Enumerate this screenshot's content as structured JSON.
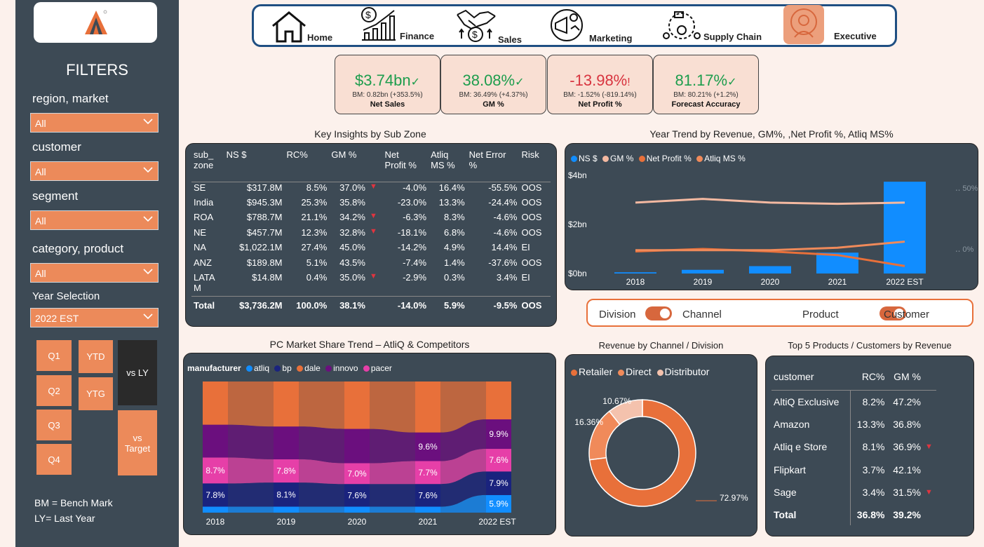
{
  "sidebar": {
    "heading": "FILTERS",
    "filters": [
      {
        "label": "region, market",
        "value": "All"
      },
      {
        "label": "customer",
        "value": "All"
      },
      {
        "label": "segment",
        "value": "All"
      },
      {
        "label": "category, product",
        "value": "All"
      },
      {
        "label": "Year Selection",
        "value": "2022 EST"
      }
    ],
    "quarters": [
      "Q1",
      "Q2",
      "Q3",
      "Q4"
    ],
    "ytd": "YTD",
    "ytg": "YTG",
    "vs_ly": "vs LY",
    "vs_target": "vs\nTarget",
    "bm_note": "BM = Bench Mark",
    "ly_note": "LY= Last Year"
  },
  "nav": {
    "items": [
      "Home",
      "Finance",
      "Sales",
      "Marketing",
      "Supply Chain",
      "Executive"
    ]
  },
  "kpis": [
    {
      "value": "$3.74bn",
      "mark": "✓",
      "bm": "BM: 0.82bn (+353.5%)",
      "label": "Net Sales",
      "color": "#1d9d4d"
    },
    {
      "value": "38.08%",
      "mark": "✓",
      "bm": "BM: 36.49% (+4.37%)",
      "label": "GM %",
      "color": "#1d9d4d"
    },
    {
      "value": "-13.98%",
      "mark": "!",
      "bm": "BM: -1.52% (-819.14%)",
      "label": "Net Profit %",
      "color": "#d8343f"
    },
    {
      "value": "81.17%",
      "mark": "✓",
      "bm": "BM: 80.21% (+1.2%)",
      "label": "Forecast Accuracy",
      "color": "#1d9d4d"
    }
  ],
  "insights": {
    "title": "Key Insights by Sub Zone",
    "headers": [
      "sub_\nzone",
      "NS $",
      "RC%",
      "GM %",
      "Net\nProfit %",
      "Atliq\nMS %",
      "Net Error\n%",
      "Risk"
    ],
    "rows": [
      [
        "SE",
        "$317.8M",
        "8.5%",
        "37.0%",
        "-4.0%",
        "16.4%",
        "-55.5%",
        "OOS"
      ],
      [
        "India",
        "$945.3M",
        "25.3%",
        "35.8%",
        "-23.0%",
        "13.3%",
        "-24.4%",
        "OOS"
      ],
      [
        "ROA",
        "$788.7M",
        "21.1%",
        "34.2%",
        "-6.3%",
        "8.3%",
        "-4.6%",
        "OOS"
      ],
      [
        "NE",
        "$457.7M",
        "12.3%",
        "32.8%",
        "-18.1%",
        "6.8%",
        "-4.6%",
        "OOS"
      ],
      [
        "NA",
        "$1,022.1M",
        "27.4%",
        "45.0%",
        "-14.2%",
        "4.9%",
        "14.4%",
        "EI"
      ],
      [
        "ANZ",
        "$189.8M",
        "5.1%",
        "43.5%",
        "-7.4%",
        "1.4%",
        "-37.6%",
        "OOS"
      ],
      [
        "LATA\nM",
        "$14.8M",
        "0.4%",
        "35.0%",
        "-2.9%",
        "0.3%",
        "3.4%",
        "EI"
      ]
    ],
    "down_flags": [
      true,
      false,
      true,
      true,
      false,
      false,
      true
    ],
    "total": [
      "Total",
      "$3,736.2M",
      "100.0%",
      "38.1%",
      "-14.0%",
      "5.9%",
      "-9.5%",
      "OOS"
    ]
  },
  "trend": {
    "title": "Year Trend by Revenue, GM%, ,Net Profit %, Atliq MS%",
    "legend": [
      {
        "name": "NS $",
        "color": "#118dff"
      },
      {
        "name": "GM %",
        "color": "#f4b9a1"
      },
      {
        "name": "Net Profit %",
        "color": "#e8703a"
      },
      {
        "name": "Atliq MS %",
        "color": "#f08a5a"
      }
    ]
  },
  "toggles": {
    "a": "Division",
    "b": "Channel",
    "c": "Product",
    "d": "Customer"
  },
  "market": {
    "title": "PC Market Share Trend – AtliQ  & Competitors",
    "legend_title": "manufacturer",
    "legend": [
      {
        "name": "atliq",
        "color": "#118dff"
      },
      {
        "name": "bp",
        "color": "#1a237e"
      },
      {
        "name": "dale",
        "color": "#e8703a"
      },
      {
        "name": "innovo",
        "color": "#6b0f7e"
      },
      {
        "name": "pacer",
        "color": "#e63fa8"
      }
    ]
  },
  "channel": {
    "title": "Revenue by Channel / Division",
    "legend": [
      {
        "name": "Retailer",
        "color": "#e8703a"
      },
      {
        "name": "Direct",
        "color": "#f08a5a"
      },
      {
        "name": "Distributor",
        "color": "#f4c2ad"
      }
    ]
  },
  "top5": {
    "title": "Top 5 Products / Customers by Revenue",
    "headers": [
      "customer",
      "RC%",
      "GM %"
    ],
    "rows": [
      [
        "AltiQ Exclusive",
        "8.2%",
        "47.2%"
      ],
      [
        "Amazon",
        "13.3%",
        "36.8%"
      ],
      [
        "Atliq e Store",
        "8.1%",
        "36.9%"
      ],
      [
        "Flipkart",
        "3.7%",
        "42.1%"
      ],
      [
        "Sage",
        "3.4%",
        "31.5%"
      ]
    ],
    "down_flags": [
      false,
      false,
      true,
      false,
      true
    ],
    "total": [
      "Total",
      "36.8%",
      "39.2%"
    ]
  },
  "chart_data": [
    {
      "type": "bar",
      "title": "Year Trend by Revenue, GM%, ,Net Profit %, Atliq MS%",
      "categories": [
        "2018",
        "2019",
        "2020",
        "2021",
        "2022 EST"
      ],
      "y_ticks": [
        "$0bn",
        "$2bn",
        "$4bn"
      ],
      "y2_ticks": [
        "0%",
        "50%"
      ],
      "ylim": [
        0,
        4
      ],
      "series": [
        {
          "name": "NS $",
          "type": "bar",
          "values": [
            0.05,
            0.15,
            0.3,
            0.85,
            3.74
          ]
        },
        {
          "name": "GM %",
          "type": "line",
          "values": [
            0.38,
            0.41,
            0.38,
            0.37,
            0.38
          ]
        },
        {
          "name": "Net Profit %",
          "type": "line",
          "values": [
            -0.02,
            0.0,
            -0.02,
            -0.05,
            -0.14
          ]
        },
        {
          "name": "Atliq MS %",
          "type": "line",
          "values": [
            -0.01,
            -0.01,
            -0.01,
            0.01,
            0.06
          ]
        }
      ]
    },
    {
      "type": "area",
      "title": "PC Market Share Trend – AtliQ  & Competitors",
      "categories": [
        "2018",
        "2019",
        "2020",
        "2021",
        "2022 EST"
      ],
      "series": [
        {
          "name": "atliq",
          "values": [
            2.0,
            2.0,
            2.0,
            2.0,
            5.9
          ]
        },
        {
          "name": "bp",
          "values": [
            7.8,
            8.1,
            7.6,
            7.6,
            7.9
          ]
        },
        {
          "name": "pacer",
          "values": [
            8.7,
            7.8,
            7.0,
            7.7,
            7.6
          ]
        },
        {
          "name": "innovo",
          "values": [
            11.0,
            11.0,
            11.5,
            9.6,
            9.9
          ]
        },
        {
          "name": "dale",
          "values": [
            30.0,
            30.0,
            30.0,
            30.0,
            30.0
          ]
        }
      ],
      "labels": [
        [
          "7.8%",
          "8.7%"
        ],
        [
          "8.1%",
          "7.8%"
        ],
        [
          "7.6%",
          "7.0%"
        ],
        [
          "7.6%",
          "7.7%",
          "9.6%"
        ],
        [
          "5.9%",
          "7.6%",
          "7.9%",
          "9.9%"
        ]
      ]
    },
    {
      "type": "pie",
      "title": "Revenue by Channel / Division",
      "labels": [
        "Retailer",
        "Direct",
        "Distributor"
      ],
      "values": [
        72.97,
        16.36,
        10.67
      ],
      "value_labels": [
        "72.97%",
        "16.36%",
        "10.67%"
      ]
    }
  ]
}
